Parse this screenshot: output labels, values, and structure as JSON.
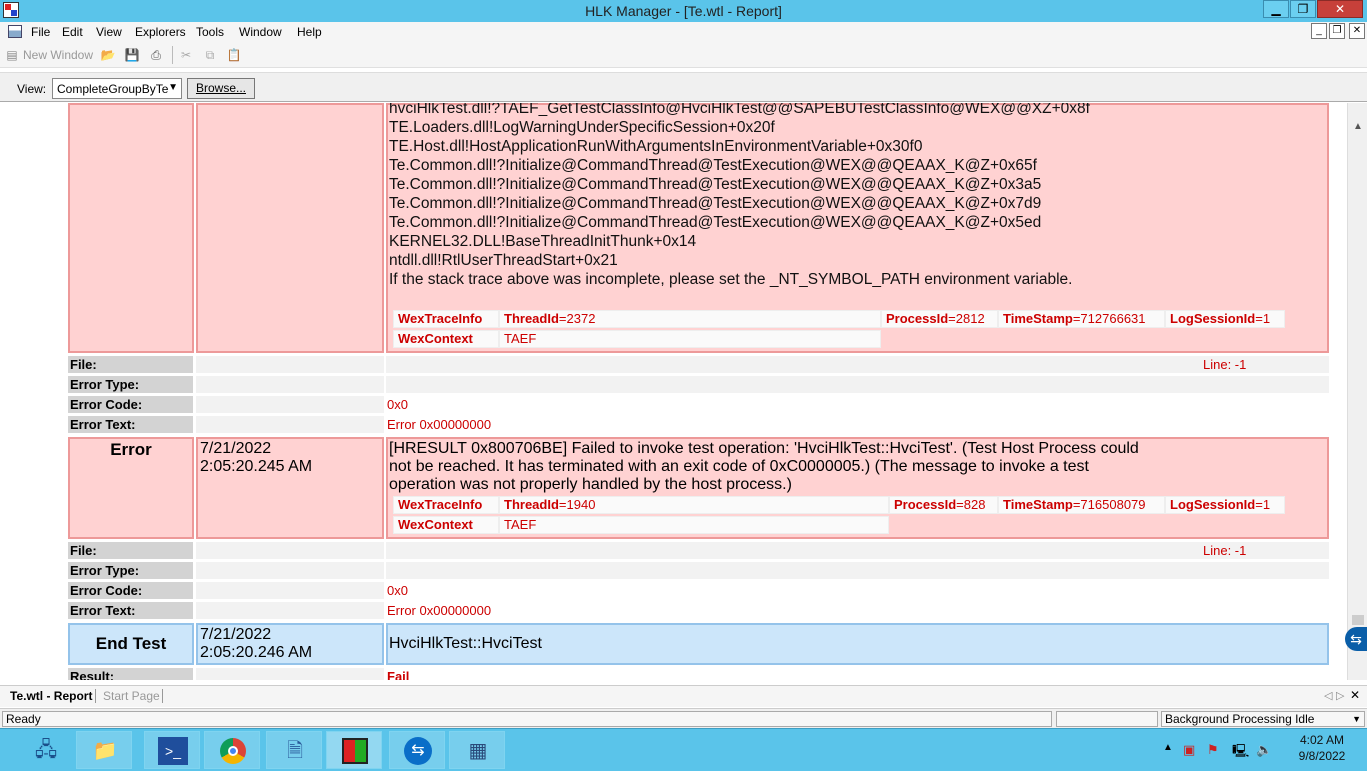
{
  "window": {
    "title": "HLK Manager - [Te.wtl - Report]",
    "minimize": "▁",
    "restore": "❐",
    "close": "✕"
  },
  "menu": [
    "File",
    "Edit",
    "View",
    "Explorers",
    "Tools",
    "Window",
    "Help"
  ],
  "toolbar": {
    "new_window": "New Window"
  },
  "viewbar": {
    "label": "View:",
    "selected": "CompleteGroupByTe",
    "browse": "Browse..."
  },
  "trace": {
    "lines": [
      "hvciHlkTest.dll!?TAEF_GetTestClassInfo@HvciHlkTest@@SAPEBUTestClassInfo@WEX@@XZ+0x8f",
      "TE.Loaders.dll!LogWarningUnderSpecificSession+0x20f",
      "TE.Host.dll!HostApplicationRunWithArgumentsInEnvironmentVariable+0x30f0",
      "Te.Common.dll!?Initialize@CommandThread@TestExecution@WEX@@QEAAX_K@Z+0x65f",
      "Te.Common.dll!?Initialize@CommandThread@TestExecution@WEX@@QEAAX_K@Z+0x3a5",
      "Te.Common.dll!?Initialize@CommandThread@TestExecution@WEX@@QEAAX_K@Z+0x7d9",
      "Te.Common.dll!?Initialize@CommandThread@TestExecution@WEX@@QEAAX_K@Z+0x5ed",
      "KERNEL32.DLL!BaseThreadInitThunk+0x14",
      "ntdll.dll!RtlUserThreadStart+0x21",
      "If the stack trace above was incomplete, please set the _NT_SYMBOL_PATH environment variable."
    ],
    "wex1": {
      "traceinfo": "WexTraceInfo",
      "thread_key": "ThreadId",
      "thread_val": "=2372",
      "process_key": "ProcessId",
      "process_val": "=2812",
      "ts_key": "TimeStamp",
      "ts_val": "=712766631",
      "log_key": "LogSessionId",
      "log_val": "=1",
      "context": "WexContext",
      "context_val": "TAEF"
    }
  },
  "labels": {
    "file": "File:",
    "error_type": "Error Type:",
    "error_code": "Error Code:",
    "error_text": "Error Text:",
    "result": "Result:"
  },
  "block1": {
    "line": "Line: -1",
    "code": "0x0",
    "text": "Error 0x00000000"
  },
  "error_event": {
    "label": "Error",
    "date": "7/21/2022",
    "time": "2:05:20.245 AM",
    "message_lines": [
      "[HRESULT 0x800706BE] Failed to invoke test operation: 'HvciHlkTest::HvciTest'. (Test Host Process could",
      "not be reached. It has terminated with an exit code of 0xC0000005.) (The message to invoke a test",
      "operation was not properly handled by the host process.)"
    ],
    "wex": {
      "traceinfo": "WexTraceInfo",
      "thread_key": "ThreadId",
      "thread_val": "=1940",
      "process_key": "ProcessId",
      "process_val": "=828",
      "ts_key": "TimeStamp",
      "ts_val": "=716508079",
      "log_key": "LogSessionId",
      "log_val": "=1",
      "context": "WexContext",
      "context_val": "TAEF"
    }
  },
  "block2": {
    "line": "Line: -1",
    "code": "0x0",
    "text": "Error 0x00000000"
  },
  "end_event": {
    "label": "End Test",
    "date": "7/21/2022",
    "time": "2:05:20.246 AM",
    "message": "HvciHlkTest::HvciTest",
    "result": "Fail"
  },
  "tabs": [
    {
      "label": "Te.wtl - Report",
      "active": true
    },
    {
      "label": "Start Page",
      "active": false
    }
  ],
  "status": {
    "left": "Ready",
    "middle": "",
    "right": "Background Processing Idle"
  },
  "taskbar": {
    "apps": [
      "server-manager",
      "file-explorer",
      "powershell",
      "chrome",
      "document-app",
      "hlk-manager",
      "teamviewer",
      "control-panel"
    ],
    "clock_time": "4:02 AM",
    "clock_date": "9/8/2022"
  },
  "colors": {
    "title": "#5ac4ea",
    "error_bg": "#ffd2d2",
    "error_border": "#ed9999",
    "end_bg": "#cce6fa",
    "red_text": "#cc0000"
  }
}
